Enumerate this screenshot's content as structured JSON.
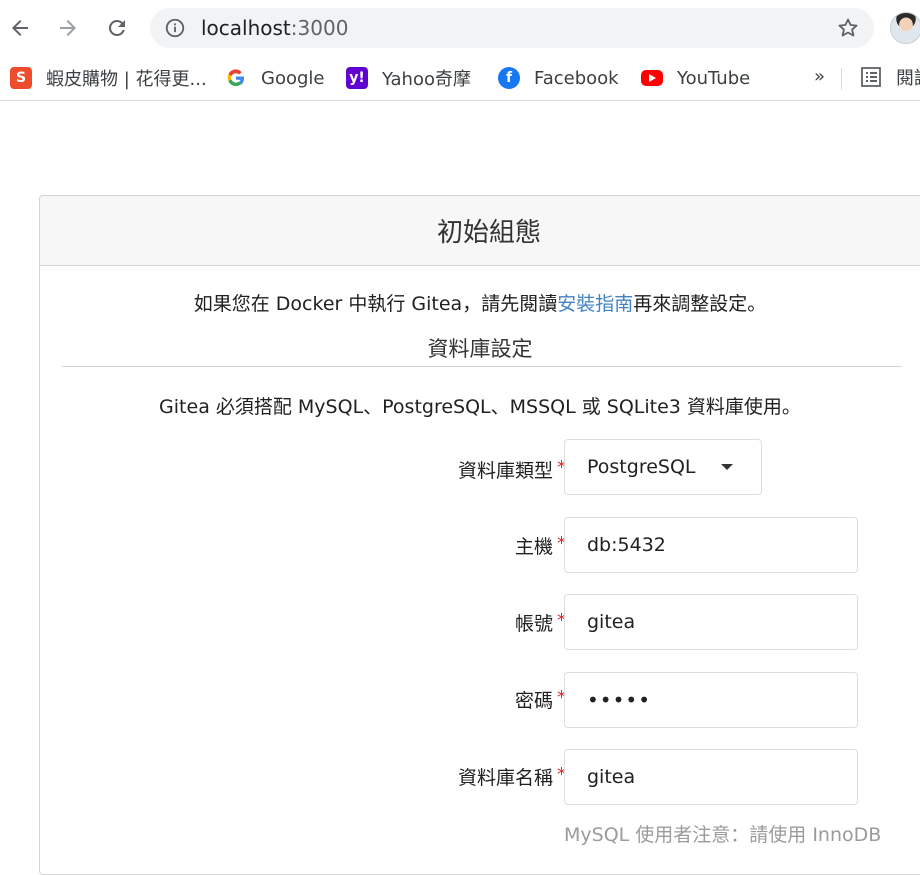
{
  "browser": {
    "url_host": "localhost",
    "url_port": ":3000",
    "bookmarks": [
      {
        "label": "蝦皮購物 | 花得更...",
        "icon": "shopee-icon",
        "color": "#ee4d2d"
      },
      {
        "label": "Google",
        "icon": "google-icon",
        "color": "#4285f4"
      },
      {
        "label": "Yahoo奇摩",
        "icon": "yahoo-icon",
        "color": "#6001d2"
      },
      {
        "label": "Facebook",
        "icon": "facebook-icon",
        "color": "#1877f2"
      },
      {
        "label": "YouTube",
        "icon": "youtube-icon",
        "color": "#ff0000"
      }
    ],
    "more_label": "»",
    "reading_list_label": "閱讀"
  },
  "page": {
    "header": "初始組態",
    "intro_before": "如果您在 Docker 中執行 Gitea，請先閱讀",
    "intro_link": "安裝指南",
    "intro_after": "再來調整設定。",
    "section_title": "資料庫設定",
    "db_note": "Gitea 必須搭配 MySQL、PostgreSQL、MSSQL 或 SQLite3 資料庫使用。",
    "fields": {
      "db_type": {
        "label": "資料庫類型",
        "value": "PostgreSQL"
      },
      "host": {
        "label": "主機",
        "value": "db:5432"
      },
      "user": {
        "label": "帳號",
        "value": "gitea"
      },
      "password": {
        "label": "密碼",
        "value": "•••••"
      },
      "db_name": {
        "label": "資料庫名稱",
        "value": "gitea"
      }
    },
    "required_mark": "*",
    "mysql_hint": "MySQL 使用者注意：請使用 InnoDB"
  },
  "colors": {
    "link": "#4183c4",
    "required": "#db2828"
  }
}
